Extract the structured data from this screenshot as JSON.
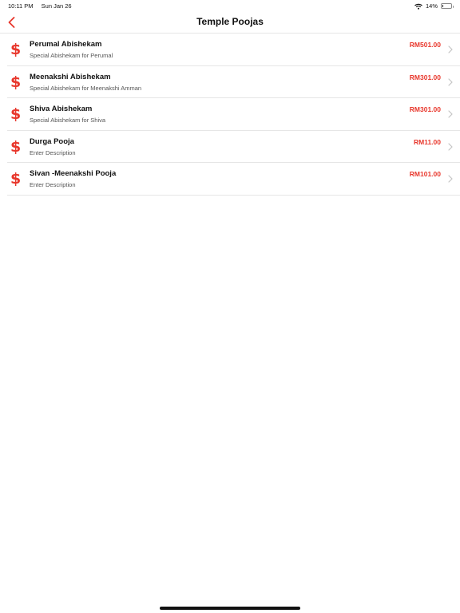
{
  "status": {
    "time": "10:11 PM",
    "date": "Sun Jan 26",
    "battery": "14%",
    "battery_level": 0.14,
    "wifi_icon": "wifi-icon"
  },
  "nav": {
    "title": "Temple Poojas",
    "back_icon": "chevron-left-icon",
    "accent": "#e8372c"
  },
  "items": [
    {
      "title": "Perumal Abishekam",
      "description": "Special Abishekam for Perumal",
      "price": "RM501.00",
      "icon": "dollar-icon"
    },
    {
      "title": "Meenakshi Abishekam",
      "description": "Special Abishekam for Meenakshi Amman",
      "price": "RM301.00",
      "icon": "dollar-icon"
    },
    {
      "title": "Shiva Abishekam",
      "description": "Special Abishekam for Shiva",
      "price": "RM301.00",
      "icon": "dollar-icon"
    },
    {
      "title": "Durga Pooja",
      "description": "Enter Description",
      "price": "RM11.00",
      "icon": "dollar-icon"
    },
    {
      "title": "Sivan -Meenakshi Pooja",
      "description": "Enter Description",
      "price": "RM101.00",
      "icon": "dollar-icon"
    }
  ]
}
